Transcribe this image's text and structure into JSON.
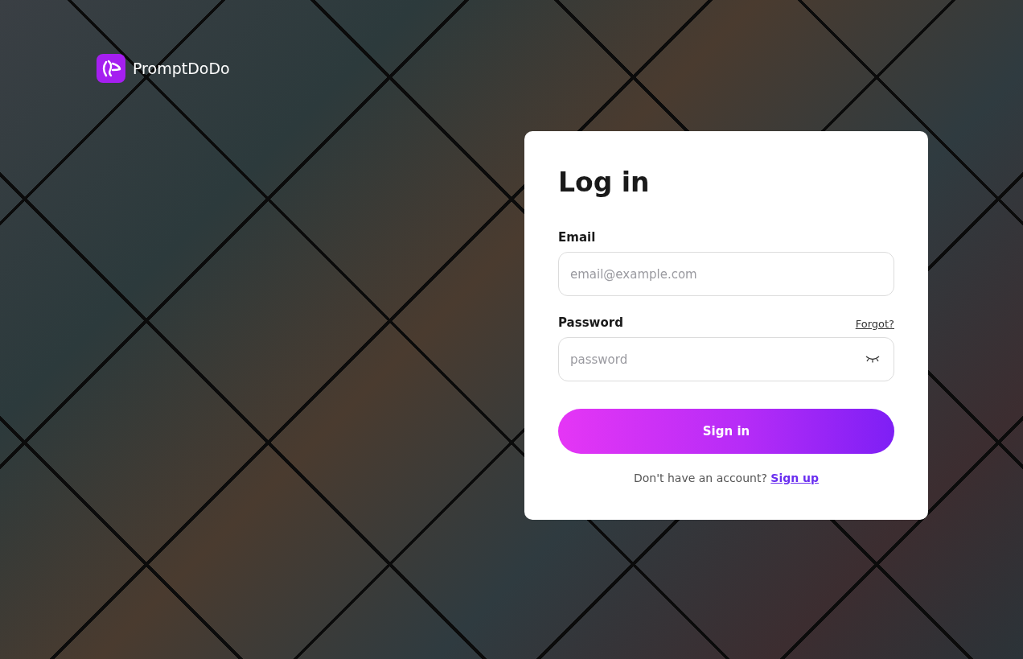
{
  "brand": {
    "name": "PromptDoDo"
  },
  "login": {
    "title": "Log in",
    "fields": [
      {
        "kind": "email",
        "label": "Email",
        "placeholder": "email@example.com"
      },
      {
        "kind": "password",
        "label": "Password",
        "placeholder": "password",
        "link": "Forgot?"
      }
    ],
    "submit": "Sign in",
    "footer": {
      "text": "Don't have an account?",
      "link": "Sign up"
    }
  }
}
